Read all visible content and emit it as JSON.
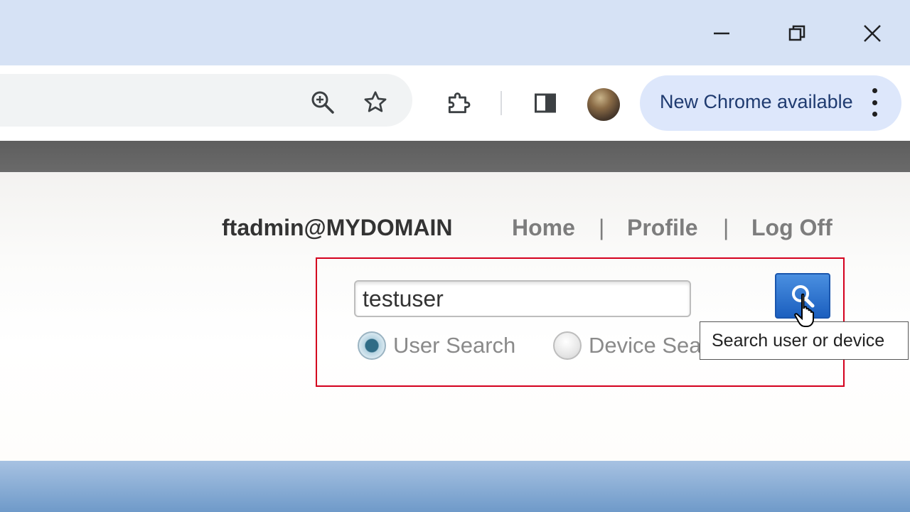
{
  "browser": {
    "update_chip_label": "New Chrome available",
    "icons": [
      "zoom-icon",
      "bookmark-star-icon",
      "extensions-icon",
      "side-panel-icon",
      "profile-avatar",
      "more-menu-icon"
    ]
  },
  "header": {
    "user": "ftadmin@MYDOMAIN",
    "nav": {
      "home": "Home",
      "profile": "Profile",
      "logoff": "Log Off",
      "separator": "|"
    }
  },
  "search": {
    "value": "testuser",
    "options": {
      "user": "User Search",
      "device": "Device Sea"
    },
    "selected": "user",
    "tooltip": "Search user or device"
  },
  "colors": {
    "highlight_box": "#d4001e",
    "search_button": "#1b5fbf",
    "chip_bg": "#dde7fb"
  }
}
